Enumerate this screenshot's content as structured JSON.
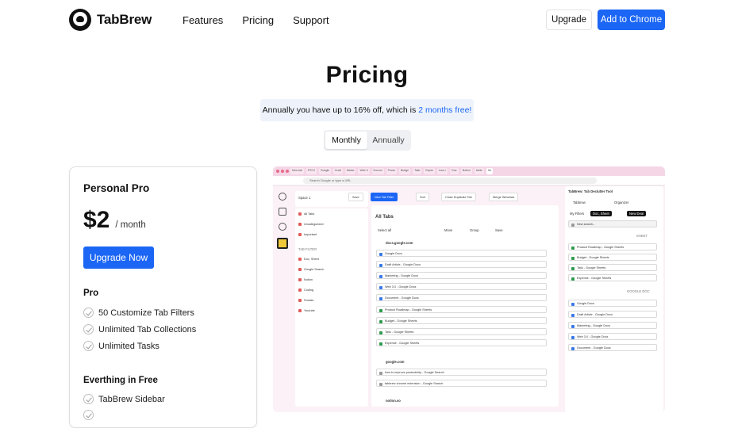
{
  "header": {
    "brand": "TabBrew",
    "nav": [
      "Features",
      "Pricing",
      "Support"
    ],
    "upgrade_label": "Upgrade",
    "chrome_label": "Add to Chrome"
  },
  "hero": {
    "title": "Pricing",
    "promo_prefix": "Annually you have up to 16% off, which is",
    "promo_highlight": "2 months free!",
    "toggle": [
      "Monthly",
      "Annually"
    ],
    "toggle_selected": "Monthly"
  },
  "plan": {
    "name": "Personal Pro",
    "price": "$2",
    "period": "/ month",
    "cta": "Upgrade Now",
    "pro_title": "Pro",
    "pro_features": [
      "50 Customize Tab Filters",
      "Unlimited Tab Collections",
      "Unlimited Tasks"
    ],
    "free_title": "Everthing in Free",
    "free_features": [
      "TabBrew Sidebar"
    ]
  },
  "mockup": {
    "url_placeholder": "Search Google or type a URL",
    "space": "Space 1",
    "sidebar_items": [
      "All Tabs",
      "Uncategorized",
      "Important"
    ],
    "tab_filter_title": "TAB FILTER",
    "filters": [
      "Doc, Sheet",
      "Google Search",
      "Notion",
      "Coding",
      "Socials",
      "Youtube"
    ],
    "toolbar": [
      "Save",
      "New Tab Filter",
      "Sort",
      "Close Duplicate Tab",
      "Merge Windows"
    ],
    "list_title": "All Tabs",
    "select_all": "Select all",
    "actions": [
      "Move",
      "Group",
      "Save"
    ],
    "domain_1": "docs.google.com",
    "rows_1": [
      "Google Docs",
      "Draft Article - Google Docs",
      "Marketing - Google Docs",
      "Web 3.0 - Google Docs",
      "Document - Google Docs",
      "Product Roadmap - Google Sheets",
      "Budget - Google Sheets",
      "Task - Google Sheets",
      "Expense - Google Sheets"
    ],
    "domain_2": "google.com",
    "rows_2": [
      "how to improve productivity - Google Search",
      "tabbrew chrome extension - Google Search"
    ],
    "domain_3": "notion.so",
    "right_title": "TabBrew: Tab Declutter Tool",
    "right_tabs": [
      "Tabbrew",
      "Organizer"
    ],
    "right_filters": [
      "My Filters",
      "Doc, Sheet",
      "New Deal"
    ],
    "search_placeholder": "New search...",
    "sheet_label": "SHEET",
    "doc_label": "GOOGLE DOC",
    "right_rows_1": [
      "Product Roadmap - Google Sheets",
      "Budget - Google Sheets",
      "Task - Google Sheets",
      "Expense - Google Sheets"
    ],
    "right_rows_2": [
      "Google Docs",
      "Draft Article - Google Docs",
      "Marketing - Google Docs",
      "Web 3.0 - Google Docs",
      "Document - Google Docs"
    ],
    "browser_tabs": [
      "New tab",
      "RTOJ",
      "Google",
      "Draft",
      "Marke",
      "Web 3",
      "Docum",
      "Produ",
      "Budge",
      "Task",
      "Expen",
      "how t",
      "Your",
      "Notion",
      "tabbr",
      "Ne"
    ]
  },
  "colors": {
    "accent": "#1b66f5",
    "promo_bg": "#eef3fb",
    "mockup_bg": "#f7e3ee"
  }
}
